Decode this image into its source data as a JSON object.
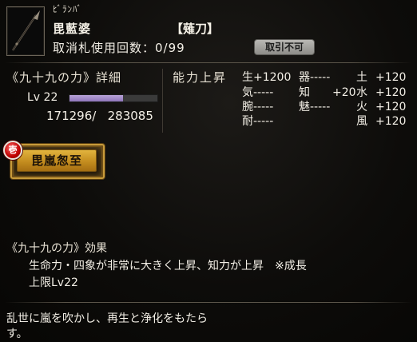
{
  "header": {
    "furigana": "ﾋﾞﾗﾝﾊﾞ",
    "name": "毘藍婆",
    "weapon": "【薙刀】",
    "cancel_count_label": "取消札使用回数：0/99",
    "badge": "取引不可",
    "icon": "naginata-icon"
  },
  "skill_detail": {
    "title": "《九十九の力》詳細",
    "level_label": "Lv 22",
    "exp_progress": 0.61,
    "exp_text": "171296/   283085"
  },
  "ability": {
    "title": "能力上昇",
    "stats": [
      {
        "label": "生",
        "value": "+1200"
      },
      {
        "label": "気",
        "value": "-----"
      },
      {
        "label": "腕",
        "value": "-----"
      },
      {
        "label": "耐",
        "value": "-----"
      },
      {
        "label": "器",
        "value": "-----"
      },
      {
        "label": "知",
        "value": "+20"
      },
      {
        "label": "魅",
        "value": "-----"
      },
      {
        "label": "土",
        "value": "+120"
      },
      {
        "label": "水",
        "value": "+120"
      },
      {
        "label": "火",
        "value": "+120"
      },
      {
        "label": "風",
        "value": "+120"
      }
    ]
  },
  "skill": {
    "mark": "壱",
    "label": "毘嵐怱至",
    "mark_color": "#c00000",
    "button_color": "#d6a22e"
  },
  "effect": {
    "title": "《九十九の力》効果",
    "line1": "生命力・四象が非常に大きく上昇、知力が上昇　※成長",
    "line2": "上限Lv22"
  },
  "flavor": {
    "line1": "乱世に嵐を吹かし、再生と浄化をもたら",
    "line2": "す。"
  }
}
